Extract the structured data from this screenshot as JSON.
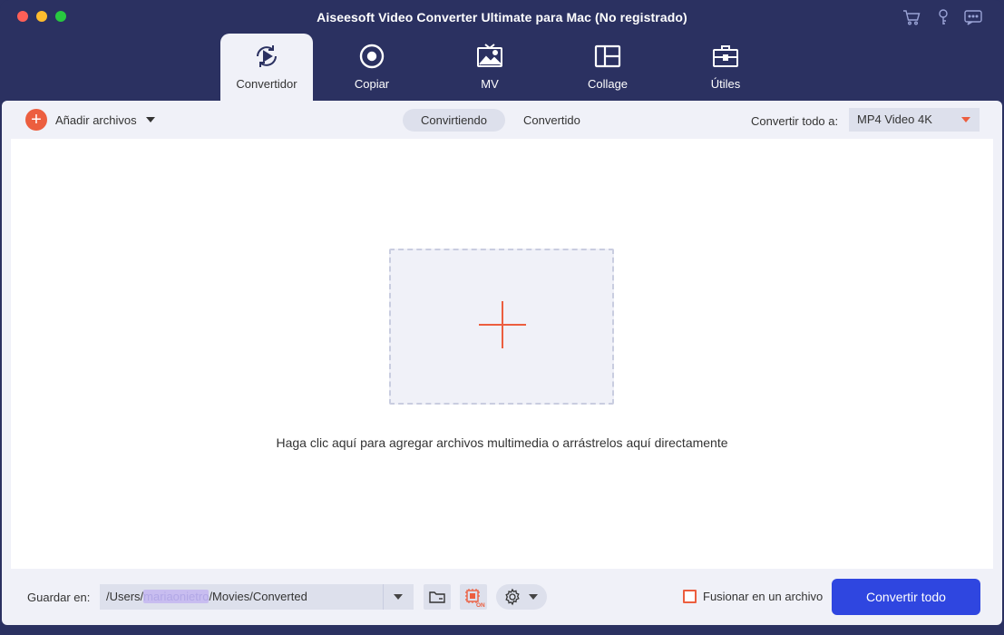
{
  "window": {
    "title": "Aiseesoft Video Converter Ultimate para Mac (No registrado)"
  },
  "titlebar_icons": [
    "cart-icon",
    "key-icon",
    "chat-icon"
  ],
  "main_tabs": [
    {
      "label": "Convertidor",
      "icon": "convert-icon",
      "active": true
    },
    {
      "label": "Copiar",
      "icon": "disc-icon",
      "active": false
    },
    {
      "label": "MV",
      "icon": "mv-icon",
      "active": false
    },
    {
      "label": "Collage",
      "icon": "collage-icon",
      "active": false
    },
    {
      "label": "Útiles",
      "icon": "toolbox-icon",
      "active": false
    }
  ],
  "toolbar": {
    "add_files_label": "Añadir archivos",
    "segments": [
      {
        "label": "Convirtiendo",
        "active": true
      },
      {
        "label": "Convertido",
        "active": false
      }
    ],
    "convert_to_label": "Convertir todo a:",
    "format_value": "MP4 Video 4K"
  },
  "content": {
    "hint": "Haga clic aquí para agregar archivos multimedia o arrástrelos aquí directamente"
  },
  "bottom": {
    "save_label": "Guardar en:",
    "path_prefix": "/Users/",
    "path_user": "mariaonietro",
    "path_suffix": "/Movies/Converted",
    "hw_badge": "ON",
    "merge_label": "Fusionar en un archivo",
    "merge_checked": false,
    "convert_all_label": "Convertir todo"
  },
  "colors": {
    "frame": "#2b3161",
    "accent": "#ec5e3f",
    "primary_button": "#2f46e0",
    "panel": "#f0f1f8"
  }
}
